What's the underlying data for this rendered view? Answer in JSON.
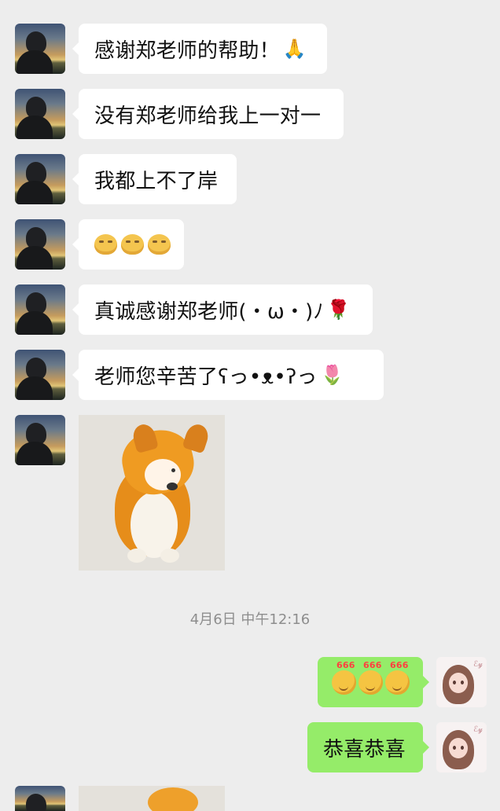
{
  "messages": [
    {
      "text": "感谢郑老师的帮助！",
      "emoji": "🙏"
    },
    {
      "text": "没有郑老师给我上一对一"
    },
    {
      "text": "我都上不了岸"
    },
    {
      "text": ""
    },
    {
      "text": "真诚感谢郑老师(・ω・)ﾉ",
      "emoji": "🌹"
    },
    {
      "text": "老师您辛苦了ʕっ•ᴥ•ʔっ",
      "emoji": "🌷"
    }
  ],
  "timestamp": "4月6日 中午12:16",
  "outgoing": {
    "congrats": "恭喜恭喜"
  },
  "avatar_right_mark": "ℰ𝓎"
}
